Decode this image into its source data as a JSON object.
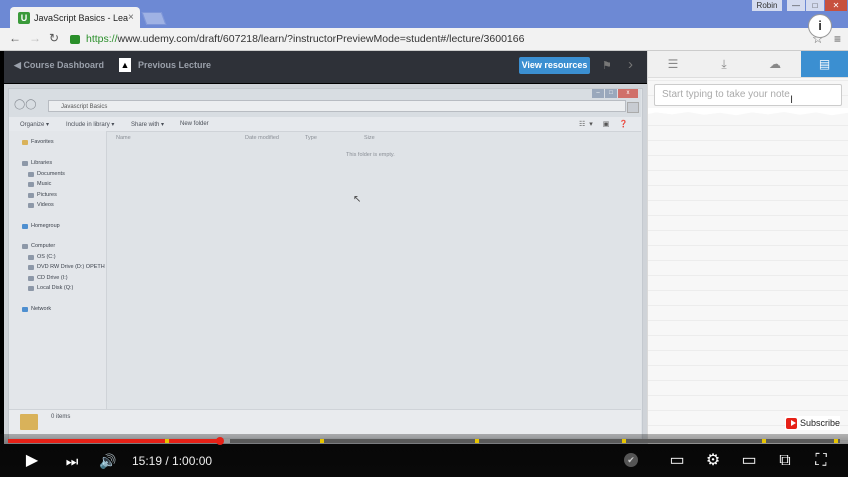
{
  "browser": {
    "tab_title": "JavaScript Basics - Learnin",
    "favicon_letter": "U",
    "user_name": "Robin",
    "url_scheme": "https://",
    "url_rest": "www.udemy.com/draft/607218/learn/?instructorPreviewMode=student#/lecture/3600166",
    "close_glyph": "×",
    "win_min": "—",
    "win_max": "□",
    "win_close": "✕",
    "info_glyph": "i",
    "menu_glyph": "≡",
    "star_glyph": "☆"
  },
  "lecture_bar": {
    "course_dashboard": "Course Dashboard",
    "previous_lecture": "Previous Lecture",
    "view_resources": "View resources",
    "flag_icon": "flag-icon",
    "next_icon": "chevron-right-icon"
  },
  "explorer": {
    "path": "Javascript Basics",
    "toolbar": [
      "Organize ▾",
      "Include in library ▾",
      "Share with ▾",
      "New folder"
    ],
    "columns": [
      "Name",
      "Date modified",
      "Type",
      "Size"
    ],
    "empty_message": "This folder is empty.",
    "nav": {
      "favorites": "Favorites",
      "libraries": "Libraries",
      "documents": "Documents",
      "music": "Music",
      "pictures": "Pictures",
      "videos": "Videos",
      "homegroup": "Homegroup",
      "computer": "Computer",
      "os": "OS (C:)",
      "dvd": "DVD RW Drive (D:) OPETH",
      "cd": "CD Drive (I:)",
      "local": "Local Disk (Q:)",
      "network": "Network"
    },
    "item_count": "0 items"
  },
  "notes_panel": {
    "tabs": [
      "list-icon",
      "download-icon",
      "comments-icon",
      "notes-icon"
    ],
    "tab_glyphs": [
      "☰",
      "⤓",
      "☁",
      "▤"
    ],
    "active_tab": 3,
    "note_placeholder": "Start typing to take your note",
    "subscribe": "Subscribe"
  },
  "player": {
    "current_time": "15:19",
    "separator": " / ",
    "duration": "1:00:00",
    "progress_fraction": 0.255,
    "buffered_fraction": 0.267,
    "play_glyph": "▶",
    "next_glyph": "⏭",
    "volume_glyph": "🔊",
    "captions_glyph": "▭",
    "settings_glyph": "⚙",
    "theater_glyph": "▭",
    "cast_glyph": "⧉",
    "fullscreen_glyph": "⛶",
    "check_glyph": "✔",
    "colors": {
      "played": "#e62117",
      "ad_marker": "#e6c400"
    }
  }
}
